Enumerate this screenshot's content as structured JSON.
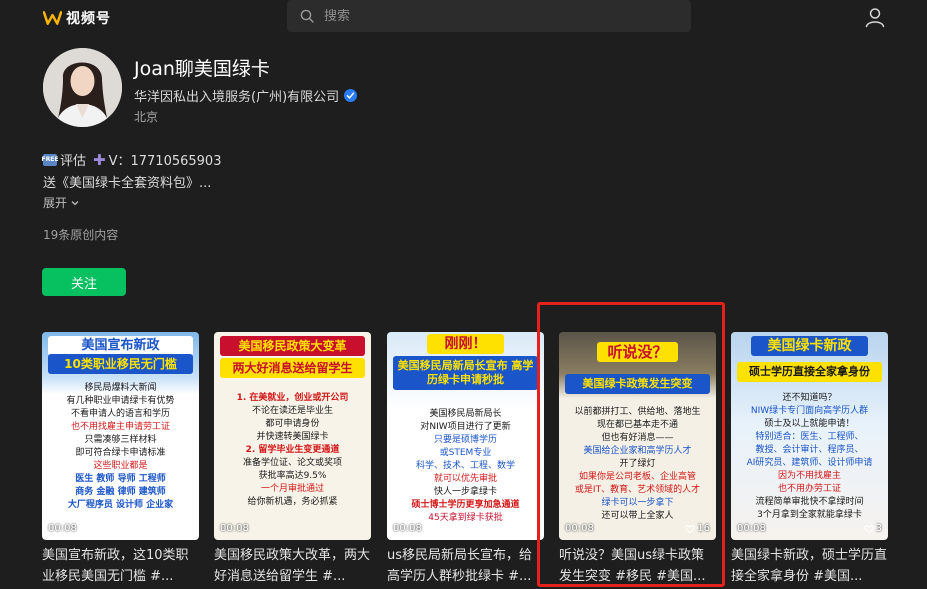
{
  "header": {
    "brand": "视频号",
    "search_placeholder": "搜索"
  },
  "profile": {
    "name": "Joan聊美国绿卡",
    "company": "华洋因私出入境服务(广州)有限公司",
    "location": "北京",
    "bio_line1_a": "评估",
    "bio_line1_b": "V：17710565903",
    "bio_line2": "送《美国绿卡全套资料包》...",
    "expand_label": "展开",
    "original_count": "19条原创内容",
    "follow_label": "关注"
  },
  "videos": [
    {
      "banner": "美国宣布新政",
      "banner2": "10类职业移民无门槛",
      "lines": [
        "移民局爆料大新闻",
        "有几种职业申请绿卡有优势",
        "不看申请人的语言和学历",
        "也不用找雇主申请劳工证",
        "只需凑够三样材料",
        "即可符合绿卡申请标准",
        "这些职业都是",
        "医生 教师 导师 工程师",
        "商务 金融 律师 建筑师",
        "大厂程序员 设计师 企业家"
      ],
      "duration": "00:08",
      "likes": "",
      "caption": "美国宣布新政，这10类职业移民美国无门槛 #..."
    },
    {
      "banner": "美国移民政策大变革",
      "banner2": "两大好消息送给留学生",
      "lines": [
        "1. 在美就业，创业或开公司",
        "不论在读还是毕业生",
        "都可申请身份",
        "并快速转美国绿卡",
        "2. 留学毕业生变更通道",
        "准备学位证、论文或奖项",
        "获批率高达9.5%",
        "一个月审批通过",
        "给你新机遇，务必抓紧"
      ],
      "duration": "00:08",
      "likes": "",
      "caption": "美国移民政策大改革，两大好消息送给留学生 #..."
    },
    {
      "banner": "刚刚！",
      "banner2": "美国移民局新局长宣布 高学历绿卡申请秒批",
      "lines": [
        "美国移民局新局长",
        "对NIW项目进行了更新",
        "只要是硕博学历",
        "或STEM专业",
        "科学、技术、工程、数学",
        "就可以优先审批",
        "快人一步拿绿卡",
        "硕士博士学历更享加急通道",
        "45天拿到绿卡获批"
      ],
      "duration": "00:08",
      "likes": "",
      "caption": "us移民局新局长宣布，给高学历人群秒批绿卡 #..."
    },
    {
      "banner": "听说没？",
      "banner2": "美国绿卡政策发生突变",
      "lines": [
        "以前都拼打工、供给地、落地生",
        "现在都已基本走不通",
        "但也有好消息——",
        "美国给企业家和高学历人才",
        "开了绿灯",
        "如果你是公司老板、企业高管",
        "或是IT、教育、艺术领域的人才",
        "绿卡可以一步拿下",
        "还可以带上全家人"
      ],
      "duration": "00:08",
      "likes": "16",
      "caption": "听说没？美国us绿卡政策发生突变 #移民 #美国..."
    },
    {
      "banner": "美国绿卡新政",
      "banner2": "硕士学历直接全家拿身份",
      "lines": [
        "还不知道吗？",
        "NIW绿卡专门面向高学历人群",
        "硕士及以上就能申请！",
        "特别适合：医生、工程师、",
        "教授、会计审计、程序员、",
        "AI研究员、建筑师、设计师申请",
        "因为不用找雇主",
        "也不用办劳工证",
        "流程简单审批快不拿绿时间",
        "3个月拿到全家就能拿绿卡"
      ],
      "duration": "00:08",
      "likes": "3",
      "caption": "美国绿卡新政，硕士学历直接全家拿身份 #美国..."
    }
  ]
}
